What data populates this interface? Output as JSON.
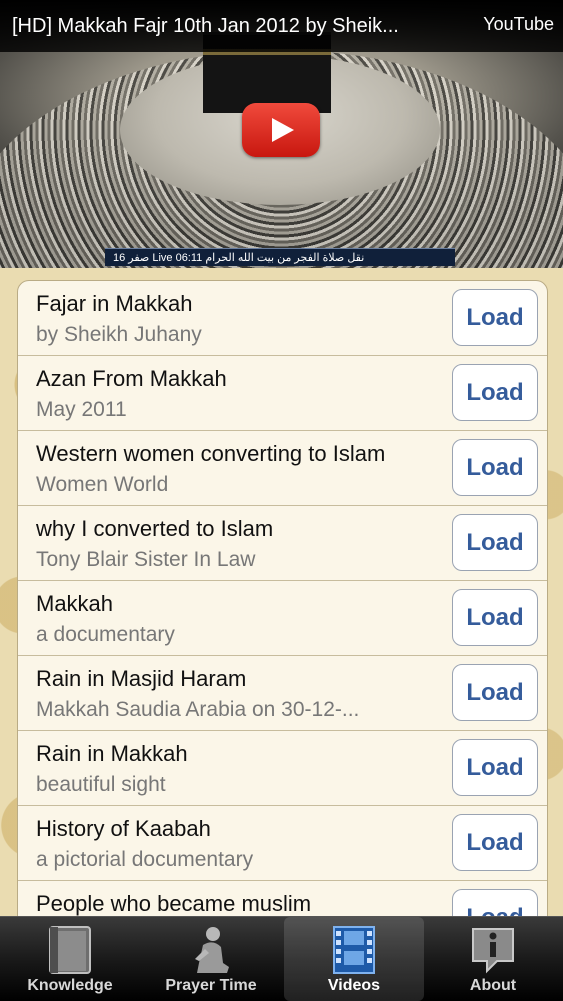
{
  "video": {
    "title": "[HD] Makkah Fajr 10th Jan 2012 by Sheik...",
    "brand": "YouTube",
    "ticker": "16 صفر   Live 06:11   نقل صلاة الفجر من بيت الله الحرام"
  },
  "videos": [
    {
      "title": "Fajar in Makkah",
      "subtitle": "by Sheikh Juhany",
      "button": "Load"
    },
    {
      "title": "Azan From Makkah",
      "subtitle": "May 2011",
      "button": "Load"
    },
    {
      "title": "Western women converting to Islam",
      "subtitle": "Women World",
      "button": "Load"
    },
    {
      "title": "why I converted to Islam",
      "subtitle": "Tony Blair Sister In Law",
      "button": "Load"
    },
    {
      "title": "Makkah",
      "subtitle": "a documentary",
      "button": "Load"
    },
    {
      "title": "Rain in Masjid Haram",
      "subtitle": "Makkah Saudia Arabia on 30-12-...",
      "button": "Load"
    },
    {
      "title": "Rain in Makkah",
      "subtitle": "beautiful sight",
      "button": "Load"
    },
    {
      "title": "History of Kaabah",
      "subtitle": "a pictorial documentary",
      "button": "Load"
    },
    {
      "title": "People who became muslim",
      "subtitle": "",
      "button": "Load"
    }
  ],
  "tabs": [
    {
      "label": "Knowledge",
      "icon": "book-icon"
    },
    {
      "label": "Prayer Time",
      "icon": "praying-person-icon"
    },
    {
      "label": "Videos",
      "icon": "film-strip-icon",
      "active": true
    },
    {
      "label": "About",
      "icon": "info-icon"
    }
  ],
  "colors": {
    "accent_button_text": "#355c9b",
    "play_button": "#e02a1e",
    "background": "#eadcb1"
  }
}
